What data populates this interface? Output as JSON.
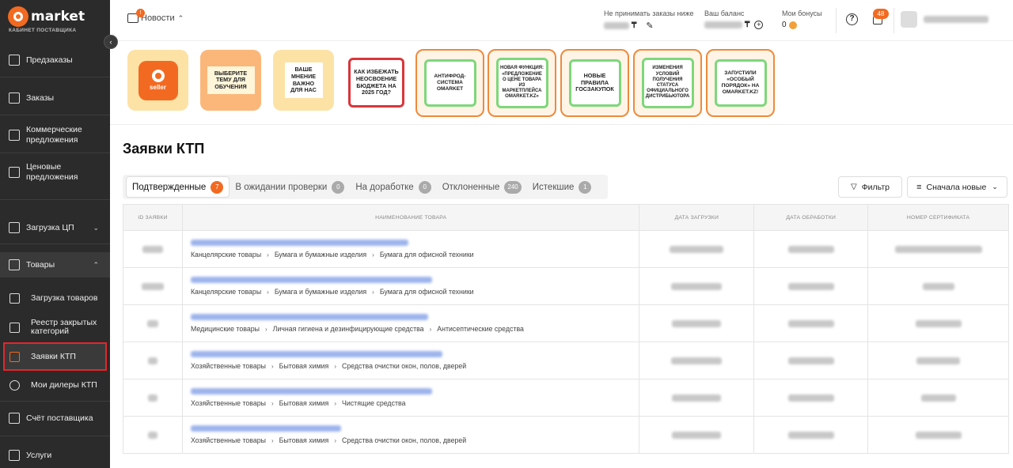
{
  "logo": {
    "name": "market",
    "subtitle": "КАБИНЕТ ПОСТАВЩИКА"
  },
  "sidebar": {
    "items": [
      {
        "label": "Предзаказы"
      },
      {
        "label": "Заказы"
      },
      {
        "label": "Коммерческие предложения"
      },
      {
        "label": "Ценовые предложения"
      },
      {
        "label": "Загрузка ЦП"
      },
      {
        "label": "Товары"
      },
      {
        "label": "Счёт поставщика"
      },
      {
        "label": "Услуги"
      }
    ],
    "sub_items": [
      {
        "label": "Загрузка товаров"
      },
      {
        "label": "Реестр закрытых категорий"
      },
      {
        "label": "Заявки КТП"
      },
      {
        "label": "Мои дилеры КТП"
      }
    ]
  },
  "topbar": {
    "news_label": "Новости",
    "news_badge": "!",
    "no_orders_label": "Не принимать заказы ниже",
    "balance_label": "Ваш баланс",
    "bonus_label": "Мои бонусы",
    "bonus_value": "0",
    "currency": "₸",
    "notifications_count": "48",
    "help_glyph": "?"
  },
  "banners": [
    {
      "text": "seller"
    },
    {
      "text": "ВЫБЕРИТЕ ТЕМУ ДЛЯ ОБУЧЕНИЯ"
    },
    {
      "text": "ВАШЕ МНЕНИЕ ВАЖНО ДЛЯ НАС"
    },
    {
      "text": "КАК ИЗБЕЖАТЬ НЕОСВОЕНИЕ БЮДЖЕТА НА 2025 ГОД?"
    },
    {
      "text": "АНТИФРОД-СИСТЕМА OMARKET"
    },
    {
      "text": "НОВАЯ ФУНКЦИЯ: «ПРЕДЛОЖЕНИЕ О ЦЕНЕ ТОВАРА ИЗ МАРКЕТПЛЕЙСА OMARKET.KZ»"
    },
    {
      "text": "НОВЫЕ ПРАВИЛА ГОСЗАКУПОК"
    },
    {
      "text": "ИЗМЕНЕНИЯ УСЛОВИЙ ПОЛУЧЕНИЯ СТАТУСА ОФИЦИАЛЬНОГО ДИСТРИБЬЮТОРА"
    },
    {
      "text": "ЗАПУСТИЛИ «ОСОБЫЙ ПОРЯДОК» НА OMARKET.KZ!"
    }
  ],
  "page": {
    "title": "Заявки КТП"
  },
  "tabs": [
    {
      "label": "Подтвержденные",
      "count": "7"
    },
    {
      "label": "В ожидании проверки",
      "count": "0"
    },
    {
      "label": "На доработке",
      "count": "0"
    },
    {
      "label": "Отклоненные",
      "count": "240"
    },
    {
      "label": "Истекшие",
      "count": "1"
    }
  ],
  "toolbar": {
    "filter_label": "Фильтр",
    "sort_label": "Сначала новые"
  },
  "table": {
    "columns": [
      "ID ЗАЯВКИ",
      "НАИМЕНОВАНИЕ ТОВАРА",
      "ДАТА ЗАГРУЗКИ",
      "ДАТА ОБРАБОТКИ",
      "НОМЕР СЕРТИФИКАТА"
    ],
    "rows": [
      {
        "cat1": "Канцелярские товары",
        "cat2": "Бумага и бумажные изделия",
        "cat3": "Бумага для офисной техники"
      },
      {
        "cat1": "Канцелярские товары",
        "cat2": "Бумага и бумажные изделия",
        "cat3": "Бумага для офисной техники"
      },
      {
        "cat1": "Медицинские товары",
        "cat2": "Личная гигиена и дезинфицирующие средства",
        "cat3": "Антисептические средства"
      },
      {
        "cat1": "Хозяйственные товары",
        "cat2": "Бытовая химия",
        "cat3": "Средства очистки окон, полов, дверей"
      },
      {
        "cat1": "Хозяйственные товары",
        "cat2": "Бытовая химия",
        "cat3": "Чистящие средства"
      },
      {
        "cat1": "Хозяйственные товары",
        "cat2": "Бытовая химия",
        "cat3": "Средства очистки окон, полов, дверей"
      }
    ]
  }
}
